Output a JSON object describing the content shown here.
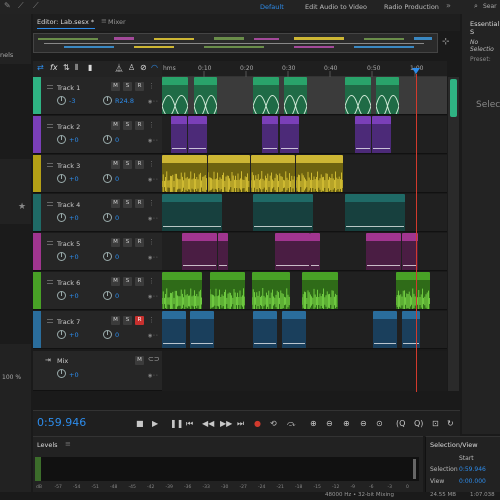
{
  "workspaces": [
    "Default",
    "Edit Audio to Video",
    "Radio Production"
  ],
  "search_placeholder": "Sear",
  "editor": {
    "tab_label": "Editor: Lab.sesx *",
    "mixer_label": "Mixer"
  },
  "left_panel": {
    "label_nels": "nels",
    "label_100": "100 %"
  },
  "right_panel": {
    "title": "Essential S",
    "no_selection": "No Selectio",
    "preset_label": "Preset:",
    "select_label": "Select"
  },
  "ruler": {
    "labels": [
      "hms",
      "0:10",
      "0:20",
      "0:30",
      "0:40",
      "0:50",
      "1:00"
    ]
  },
  "tracks": [
    {
      "name": "Track 1",
      "volume": "-3",
      "pan": "R24.8",
      "color": "#29a36a"
    },
    {
      "name": "Track 2",
      "volume": "+0",
      "pan": "0",
      "color": "#7a3fb8"
    },
    {
      "name": "Track 3",
      "volume": "+0",
      "pan": "0",
      "color": "#b4a016"
    },
    {
      "name": "Track 4",
      "volume": "+0",
      "pan": "0",
      "color": "#1f6a66"
    },
    {
      "name": "Track 5",
      "volume": "+0",
      "pan": "0",
      "color": "#a0358f"
    },
    {
      "name": "Track 6",
      "volume": "+0",
      "pan": "0",
      "color": "#48a126"
    },
    {
      "name": "Track 7",
      "volume": "+0",
      "pan": "0",
      "color": "#2a6d9c"
    }
  ],
  "mix": {
    "name": "Mix",
    "volume": "+0"
  },
  "clips": {
    "track1": [
      "D...",
      "D...",
      "D...",
      "D...",
      "D...",
      "D..."
    ],
    "track2": [
      "Digi...",
      "Unti...",
      "Digi...",
      "Unti...",
      "Digi...",
      "Unti..."
    ],
    "track3": [
      "Tr...",
      "Tr...",
      "Tr...",
      "Tr..."
    ],
    "track4": [
      "Pencil scratching",
      "Pencil scratching",
      "Pencil scratching"
    ],
    "track5": [
      "Smoke",
      "Pan",
      "Smoke",
      "Pan",
      "Smoke",
      "Pan"
    ],
    "track6": [
      "windy...",
      "windy...",
      "windy..."
    ],
    "track7": [
      "Tr...",
      "Tr...",
      "Tr...",
      "Tr...",
      "Tr...",
      "Tr..."
    ]
  },
  "transport": {
    "time": "0:59.946"
  },
  "levels": {
    "title": "Levels",
    "scale": [
      "dB",
      "-57",
      "-54",
      "-51",
      "-48",
      "-45",
      "-42",
      "-39",
      "-36",
      "-33",
      "-30",
      "-27",
      "-24",
      "-21",
      "-18",
      "-15",
      "-12",
      "-9",
      "-6",
      "-3",
      "0"
    ]
  },
  "selection_view": {
    "title": "Selection/View",
    "start_label": "Start",
    "selection_label": "Selection",
    "selection_value": "0:59.946",
    "view_label": "View",
    "view_value": "0:00.000"
  },
  "status": {
    "format": "48000 Hz • 32-bit Mixing",
    "size": "24.55 MB",
    "duration": "1:07.038"
  }
}
